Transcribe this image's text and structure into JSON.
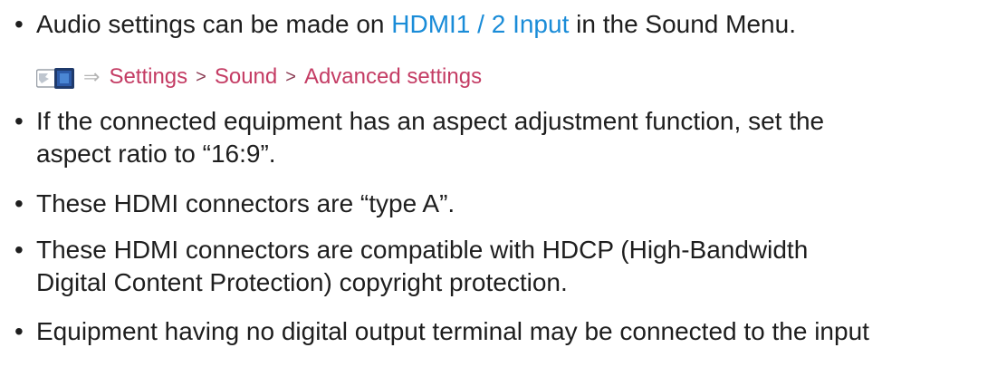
{
  "bullets": [
    {
      "lines": [
        {
          "before": "Audio settings can be made on ",
          "link": "HDMI1 / 2 Input",
          "after": " in the Sound Menu."
        }
      ]
    },
    {
      "lines": [
        {
          "text": "If the connected equipment has an aspect adjustment function, set the"
        },
        {
          "text": "aspect ratio to “16:9”."
        }
      ]
    },
    {
      "lines": [
        {
          "text": "These HDMI connectors are “type A”."
        }
      ]
    },
    {
      "lines": [
        {
          "text": "These HDMI connectors are compatible with HDCP (High-Bandwidth"
        },
        {
          "text": "Digital Content Protection) copyright protection."
        }
      ]
    },
    {
      "lines": [
        {
          "text": "Equipment having no digital output terminal may be connected to the input"
        }
      ]
    }
  ],
  "bullet_symbol": "•",
  "nav_path": {
    "icon": "menu-remote-icon",
    "arrow": "⇒",
    "separator": ">",
    "items": [
      "Settings",
      "Sound",
      "Advanced settings"
    ]
  },
  "colors": {
    "text": "#1e1e1e",
    "link_blue": "#1a8cd8",
    "nav_link": "#c43c64"
  }
}
